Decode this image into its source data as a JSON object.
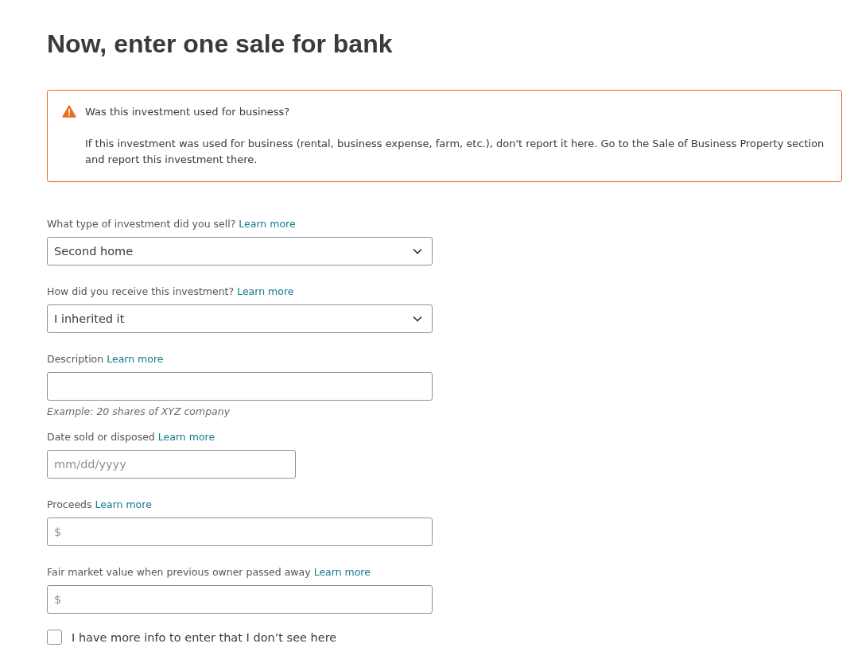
{
  "title": "Now, enter one sale for bank",
  "alert": {
    "heading": "Was this investment used for business?",
    "body": "If this investment was used for business (rental, business expense, farm, etc.), don't report it here. Go to the Sale of Business Property section and report this investment there."
  },
  "fields": [
    {
      "kind": "select",
      "label": "What type of investment did you sell?",
      "link": "Learn more",
      "value": "Second home"
    },
    {
      "kind": "select",
      "label": "How did you receive this investment?",
      "link": "Learn more",
      "value": "I inherited it"
    },
    {
      "kind": "text",
      "label": "Description",
      "link": "Learn more",
      "hint": "Example: 20 shares of XYZ company"
    },
    {
      "kind": "date",
      "label": "Date sold or disposed",
      "link": "Learn more",
      "placeholder": "mm/dd/yyyy"
    },
    {
      "kind": "money",
      "label": "Proceeds",
      "link": "Learn more",
      "prefix": "$"
    },
    {
      "kind": "money",
      "label": "Fair market value when previous owner passed away",
      "link": "Learn more",
      "prefix": "$"
    }
  ],
  "more_info": {
    "label": "I have more info to enter that I don’t see here",
    "checked": false
  }
}
